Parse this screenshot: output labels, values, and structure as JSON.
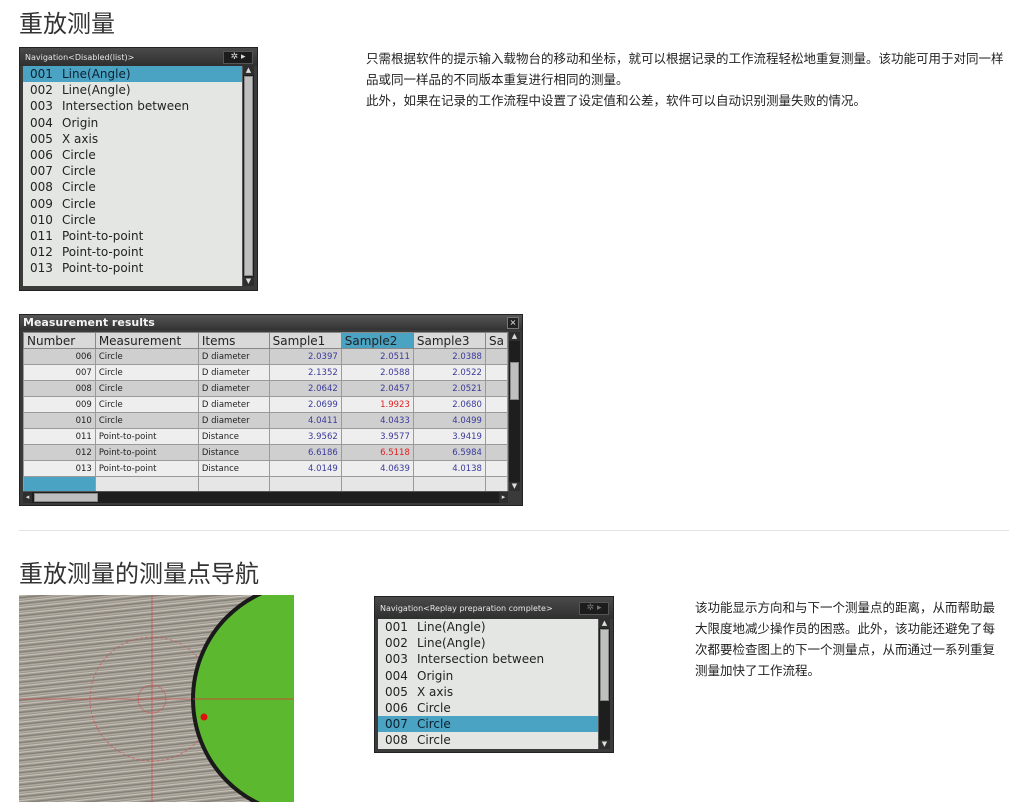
{
  "section1": {
    "title": "重放测量",
    "description": [
      "只需根据软件的提示输入载物台的移动和坐标，就可以根据记录的工作流程轻松地重复测量。该功能可用于对同一样品或同一样品的不同版本重复进行相同的测量。",
      "此外，如果在记录的工作流程中设置了设定值和公差，软件可以自动识别测量失败的情况。"
    ],
    "nav_panel": {
      "title": "Navigation<Disabled(list)>",
      "gear_icon": "gear-icon",
      "items": [
        {
          "num": "001",
          "label": "Line(Angle)",
          "selected": true
        },
        {
          "num": "002",
          "label": "Line(Angle)"
        },
        {
          "num": "003",
          "label": "Intersection between"
        },
        {
          "num": "004",
          "label": "Origin"
        },
        {
          "num": "005",
          "label": "X axis"
        },
        {
          "num": "006",
          "label": "Circle"
        },
        {
          "num": "007",
          "label": "Circle"
        },
        {
          "num": "008",
          "label": "Circle"
        },
        {
          "num": "009",
          "label": "Circle"
        },
        {
          "num": "010",
          "label": "Circle"
        },
        {
          "num": "011",
          "label": "Point-to-point"
        },
        {
          "num": "012",
          "label": "Point-to-point"
        },
        {
          "num": "013",
          "label": "Point-to-point"
        }
      ]
    },
    "results_panel": {
      "title": "Measurement results",
      "columns": [
        "Number",
        "Measurement",
        "Items",
        "Sample1",
        "Sample2",
        "Sample3",
        "Sa"
      ],
      "highlight_column": "Sample2",
      "rows": [
        {
          "num": "006",
          "measurement": "Circle",
          "item": "D diameter",
          "s1": "2.0397",
          "s2": "2.0511",
          "s3": "2.0388"
        },
        {
          "num": "007",
          "measurement": "Circle",
          "item": "D diameter",
          "s1": "2.1352",
          "s2": "2.0588",
          "s3": "2.0522"
        },
        {
          "num": "008",
          "measurement": "Circle",
          "item": "D diameter",
          "s1": "2.0642",
          "s2": "2.0457",
          "s3": "2.0521"
        },
        {
          "num": "009",
          "measurement": "Circle",
          "item": "D diameter",
          "s1": "2.0699",
          "s2": "1.9923",
          "s3": "2.0680",
          "s2_fail": true
        },
        {
          "num": "010",
          "measurement": "Circle",
          "item": "D diameter",
          "s1": "4.0411",
          "s2": "4.0433",
          "s3": "4.0499"
        },
        {
          "num": "011",
          "measurement": "Point-to-point",
          "item": "Distance",
          "s1": "3.9562",
          "s2": "3.9577",
          "s3": "3.9419"
        },
        {
          "num": "012",
          "measurement": "Point-to-point",
          "item": "Distance",
          "s1": "6.6186",
          "s2": "6.5118",
          "s3": "6.5984",
          "s2_fail": true
        },
        {
          "num": "013",
          "measurement": "Point-to-point",
          "item": "Distance",
          "s1": "4.0149",
          "s2": "4.0639",
          "s3": "4.0138"
        }
      ]
    }
  },
  "section2": {
    "title": "重放测量的测量点导航",
    "description": "该功能显示方向和与下一个测量点的距离，从而帮助最大限度地减少操作员的困惑。此外，该功能还避免了每次都要检查图上的下一个测量点，从而通过一系列重复测量加快了工作流程。",
    "nav_panel": {
      "title": "Navigation<Replay preparation complete>",
      "gear_icon": "gear-icon",
      "items": [
        {
          "num": "001",
          "label": "Line(Angle)"
        },
        {
          "num": "002",
          "label": "Line(Angle)"
        },
        {
          "num": "003",
          "label": "Intersection between"
        },
        {
          "num": "004",
          "label": "Origin"
        },
        {
          "num": "005",
          "label": "X axis"
        },
        {
          "num": "006",
          "label": "Circle"
        },
        {
          "num": "007",
          "label": "Circle",
          "selected": true
        },
        {
          "num": "008",
          "label": "Circle"
        }
      ]
    }
  },
  "colors": {
    "selection": "#4aa3c2",
    "fail_value": "#e02020",
    "value": "#3a3a9a",
    "green_part": "#5cb82e"
  }
}
